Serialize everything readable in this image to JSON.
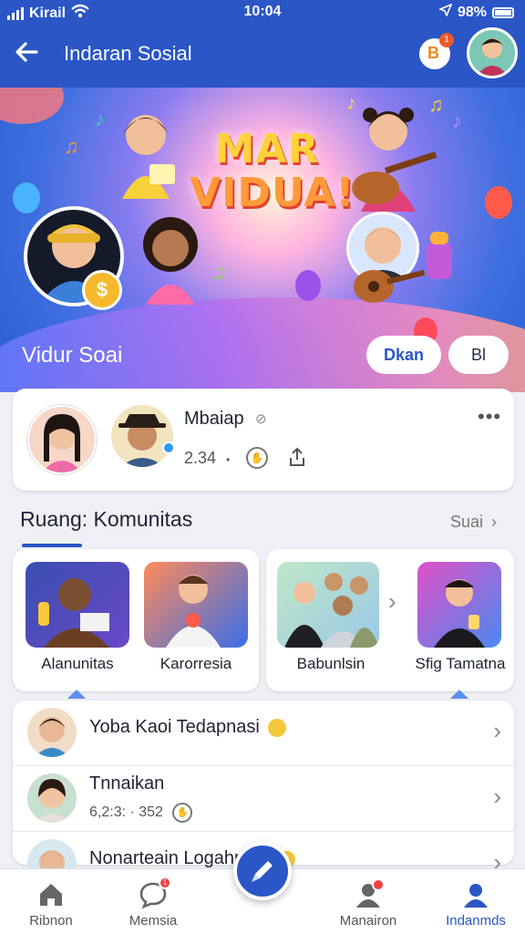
{
  "status": {
    "carrier": "Kirail",
    "time": "10:04",
    "battery": "98%"
  },
  "appbar": {
    "title": "Indaran Sosial",
    "notif_letter": "B",
    "notif_count": "1"
  },
  "hero": {
    "title_line1": "MAR",
    "title_line2": "VIDUA!",
    "name": "Vidur Soai",
    "coin_symbol": "$",
    "button_primary": "Dkan",
    "button_secondary": "Bl"
  },
  "post": {
    "name": "Mbaiap",
    "count": "2.34",
    "separator": "•"
  },
  "communities": {
    "title": "Ruang: Komunitas",
    "see_more": "Suai",
    "items": [
      {
        "label": "Alanunitas"
      },
      {
        "label": "Karorresia"
      },
      {
        "label": "Babunlsin"
      },
      {
        "label": "Sfig Tamatna"
      }
    ]
  },
  "list": {
    "items": [
      {
        "title": "Yoba Kaoi Tedapnasi",
        "subtitle": ""
      },
      {
        "title": "Tnnaikan",
        "subtitle": "6,2:3: · 352"
      },
      {
        "title": "Nonarteain Logahntah",
        "subtitle": ""
      }
    ]
  },
  "nav": {
    "items": [
      {
        "label": "Ribnon"
      },
      {
        "label": "Memsia",
        "badge": "1"
      },
      {
        "label": "Manairon"
      },
      {
        "label": "Indanmds"
      }
    ]
  },
  "colors": {
    "brand": "#2a56c6",
    "accent": "#f6b92b",
    "badge": "#f04040"
  }
}
